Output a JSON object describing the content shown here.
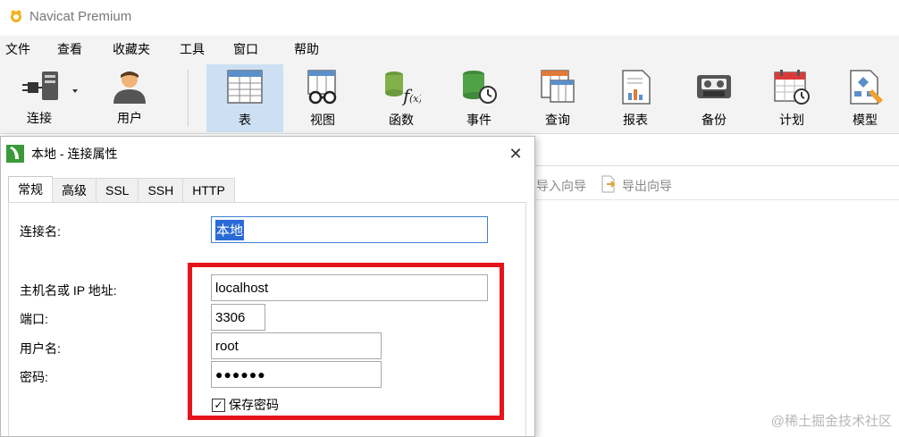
{
  "app": {
    "title": "Navicat Premium"
  },
  "menu": [
    "文件",
    "查看",
    "收藏夹",
    "工具",
    "窗口",
    "帮助"
  ],
  "toolbar": {
    "connect": "连接",
    "user": "用户",
    "table": "表",
    "view": "视图",
    "function": "函数",
    "event": "事件",
    "query": "查询",
    "report": "报表",
    "backup": "备份",
    "schedule": "计划",
    "model": "模型"
  },
  "objbar": {
    "import_wizard": "导入向导",
    "export_wizard": "导出向导"
  },
  "dialog": {
    "title": "本地 - 连接属性",
    "close": "✕",
    "tabs": [
      "常规",
      "高级",
      "SSL",
      "SSH",
      "HTTP"
    ],
    "fields": {
      "connection_name_label": "连接名:",
      "connection_name_value": "本地",
      "host_label": "主机名或 IP 地址:",
      "host_value": "localhost",
      "port_label": "端口:",
      "port_value": "3306",
      "username_label": "用户名:",
      "username_value": "root",
      "password_label": "密码:",
      "password_value": "●●●●●●",
      "save_password_label": "保存密码",
      "save_password_checked": "✓"
    }
  },
  "colors": {
    "highlight": "#e5141b",
    "active_tab": "#cde0f3",
    "selection": "#2a6ad6"
  },
  "watermark": "@稀土掘金技术社区"
}
